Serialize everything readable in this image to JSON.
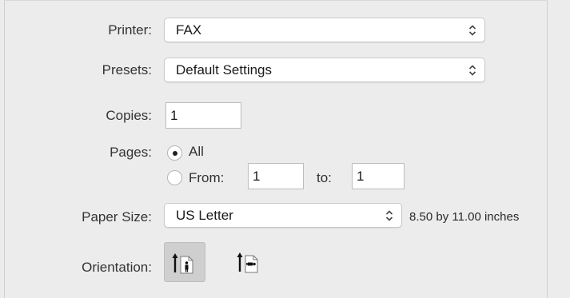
{
  "printer": {
    "label": "Printer:",
    "value": "FAX"
  },
  "presets": {
    "label": "Presets:",
    "value": "Default Settings"
  },
  "copies": {
    "label": "Copies:",
    "value": "1"
  },
  "pages": {
    "label": "Pages:",
    "all_label": "All",
    "all_selected": true,
    "from_label": "From:",
    "from_value": "1",
    "to_label": "to:",
    "to_value": "1"
  },
  "paper_size": {
    "label": "Paper Size:",
    "value": "US Letter",
    "dimensions": "8.50 by 11.00 inches"
  },
  "orientation": {
    "label": "Orientation:",
    "options": [
      {
        "name": "portrait",
        "selected": true
      },
      {
        "name": "landscape",
        "selected": false
      }
    ]
  }
}
